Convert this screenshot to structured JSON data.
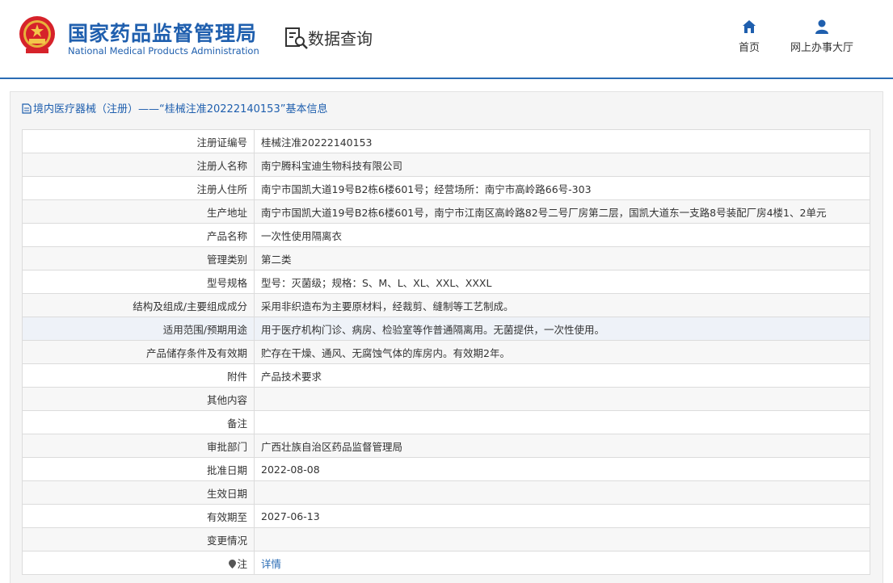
{
  "header": {
    "org_name_cn": "国家药品监督管理局",
    "org_name_en": "National Medical Products Administration",
    "section_title": "数据查询",
    "nav": [
      {
        "label": "首页",
        "icon": "home-icon"
      },
      {
        "label": "网上办事大厅",
        "icon": "user-icon"
      }
    ]
  },
  "panel": {
    "title": "境内医疗器械（注册）——“桂械注准20222140153”基本信息"
  },
  "rows": [
    {
      "label": "注册证编号",
      "value": "桂械注准20222140153"
    },
    {
      "label": "注册人名称",
      "value": "南宁腾科宝迪生物科技有限公司"
    },
    {
      "label": "注册人住所",
      "value": "南宁市国凯大道19号B2栋6楼601号；经营场所：南宁市高岭路66号-303"
    },
    {
      "label": "生产地址",
      "value": "南宁市国凯大道19号B2栋6楼601号，南宁市江南区高岭路82号二号厂房第二层，国凯大道东一支路8号装配厂房4楼1、2单元"
    },
    {
      "label": "产品名称",
      "value": "一次性使用隔离衣"
    },
    {
      "label": "管理类别",
      "value": "第二类"
    },
    {
      "label": "型号规格",
      "value": "型号：灭菌级；规格：S、M、L、XL、XXL、XXXL"
    },
    {
      "label": "结构及组成/主要组成成分",
      "value": "采用非织造布为主要原材料，经裁剪、缝制等工艺制成。"
    },
    {
      "label": "适用范围/预期用途",
      "value": "用于医疗机构门诊、病房、检验室等作普通隔离用。无菌提供，一次性使用。"
    },
    {
      "label": "产品储存条件及有效期",
      "value": "贮存在干燥、通风、无腐蚀气体的库房内。有效期2年。"
    },
    {
      "label": "附件",
      "value": "产品技术要求"
    },
    {
      "label": "其他内容",
      "value": ""
    },
    {
      "label": "备注",
      "value": ""
    },
    {
      "label": "审批部门",
      "value": "广西壮族自治区药品监督管理局"
    },
    {
      "label": "批准日期",
      "value": "2022-08-08"
    },
    {
      "label": "生效日期",
      "value": ""
    },
    {
      "label": "有效期至",
      "value": "2027-06-13"
    },
    {
      "label": "变更情况",
      "value": ""
    }
  ],
  "note_row": {
    "label": "注",
    "value": "详情",
    "icon": "info-icon"
  }
}
